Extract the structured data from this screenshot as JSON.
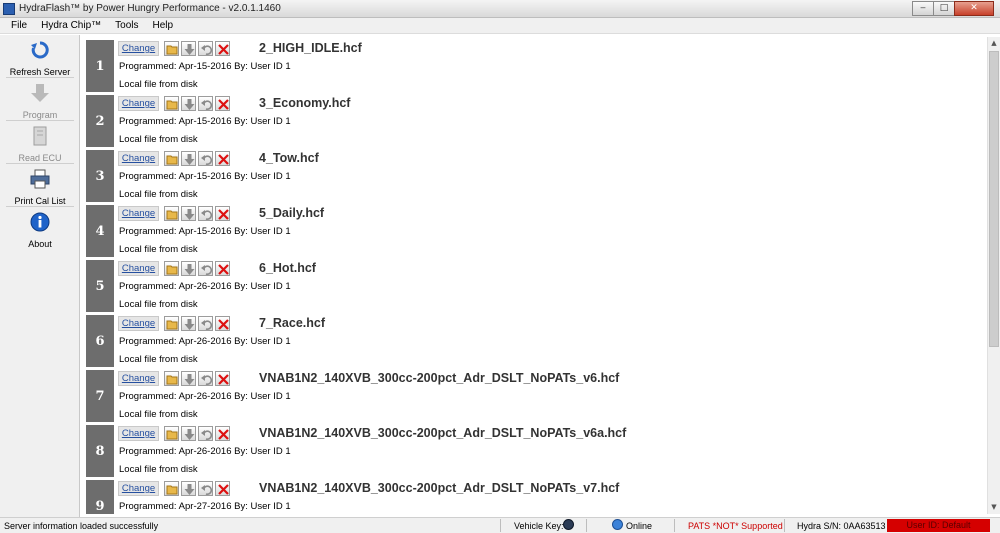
{
  "window": {
    "title": "HydraFlash™ by Power Hungry Performance - v2.0.1.1460",
    "controls": {
      "minimize": "‒",
      "maximize": "□",
      "close": "✕"
    }
  },
  "menu": [
    "File",
    "Hydra Chip™",
    "Tools",
    "Help"
  ],
  "toolbar": {
    "refresh": "Refresh Server",
    "program": "Program",
    "read": "Read ECU",
    "print": "Print Cal List",
    "about": "About"
  },
  "slots": [
    {
      "num": "1",
      "change": "Change",
      "file": "2_HIGH_IDLE.hcf",
      "programmed": "Programmed: Apr-15-2016 By: User ID 1",
      "source": "Local file from disk"
    },
    {
      "num": "2",
      "change": "Change",
      "file": "3_Economy.hcf",
      "programmed": "Programmed: Apr-15-2016 By: User ID 1",
      "source": "Local file from disk"
    },
    {
      "num": "3",
      "change": "Change",
      "file": "4_Tow.hcf",
      "programmed": "Programmed: Apr-15-2016 By: User ID 1",
      "source": "Local file from disk"
    },
    {
      "num": "4",
      "change": "Change",
      "file": "5_Daily.hcf",
      "programmed": "Programmed: Apr-15-2016 By: User ID 1",
      "source": "Local file from disk"
    },
    {
      "num": "5",
      "change": "Change",
      "file": "6_Hot.hcf",
      "programmed": "Programmed: Apr-26-2016 By: User ID 1",
      "source": "Local file from disk"
    },
    {
      "num": "6",
      "change": "Change",
      "file": "7_Race.hcf",
      "programmed": "Programmed: Apr-26-2016 By: User ID 1",
      "source": "Local file from disk"
    },
    {
      "num": "7",
      "change": "Change",
      "file": "VNAB1N2_140XVB_300cc-200pct_Adr_DSLT_NoPATs_v6.hcf",
      "programmed": "Programmed: Apr-26-2016 By: User ID 1",
      "source": "Local file from disk"
    },
    {
      "num": "8",
      "change": "Change",
      "file": "VNAB1N2_140XVB_300cc-200pct_Adr_DSLT_NoPATs_v6a.hcf",
      "programmed": "Programmed: Apr-26-2016 By: User ID 1",
      "source": "Local file from disk"
    },
    {
      "num": "9",
      "change": "Change",
      "file": "VNAB1N2_140XVB_300cc-200pct_Adr_DSLT_NoPATs_v7.hcf",
      "programmed": "Programmed: Apr-27-2016 By: User ID 1",
      "source": ""
    }
  ],
  "scrollbar": {
    "up": "▲",
    "down": "▼"
  },
  "status": {
    "message": "Server information loaded successfully",
    "vehicle_key": "Vehicle Key:",
    "online": "Online",
    "pats": "PATS *NOT* Supported",
    "serial": "Hydra S/N: 0AA63513",
    "user": "User ID: Default"
  },
  "colors": {
    "slot_number_bg": "#6d6d6d",
    "link": "#2650a0",
    "pats_text": "#cc0000",
    "user_badge_bg": "#d50000"
  },
  "icons": {
    "refresh": "refresh-arrow-icon",
    "program": "down-arrow-icon",
    "read": "ecu-chip-icon",
    "print": "printer-icon",
    "about": "info-icon",
    "open": "folder-open-icon",
    "download": "download-arrow-icon",
    "undo": "undo-icon",
    "delete": "delete-x-icon"
  }
}
